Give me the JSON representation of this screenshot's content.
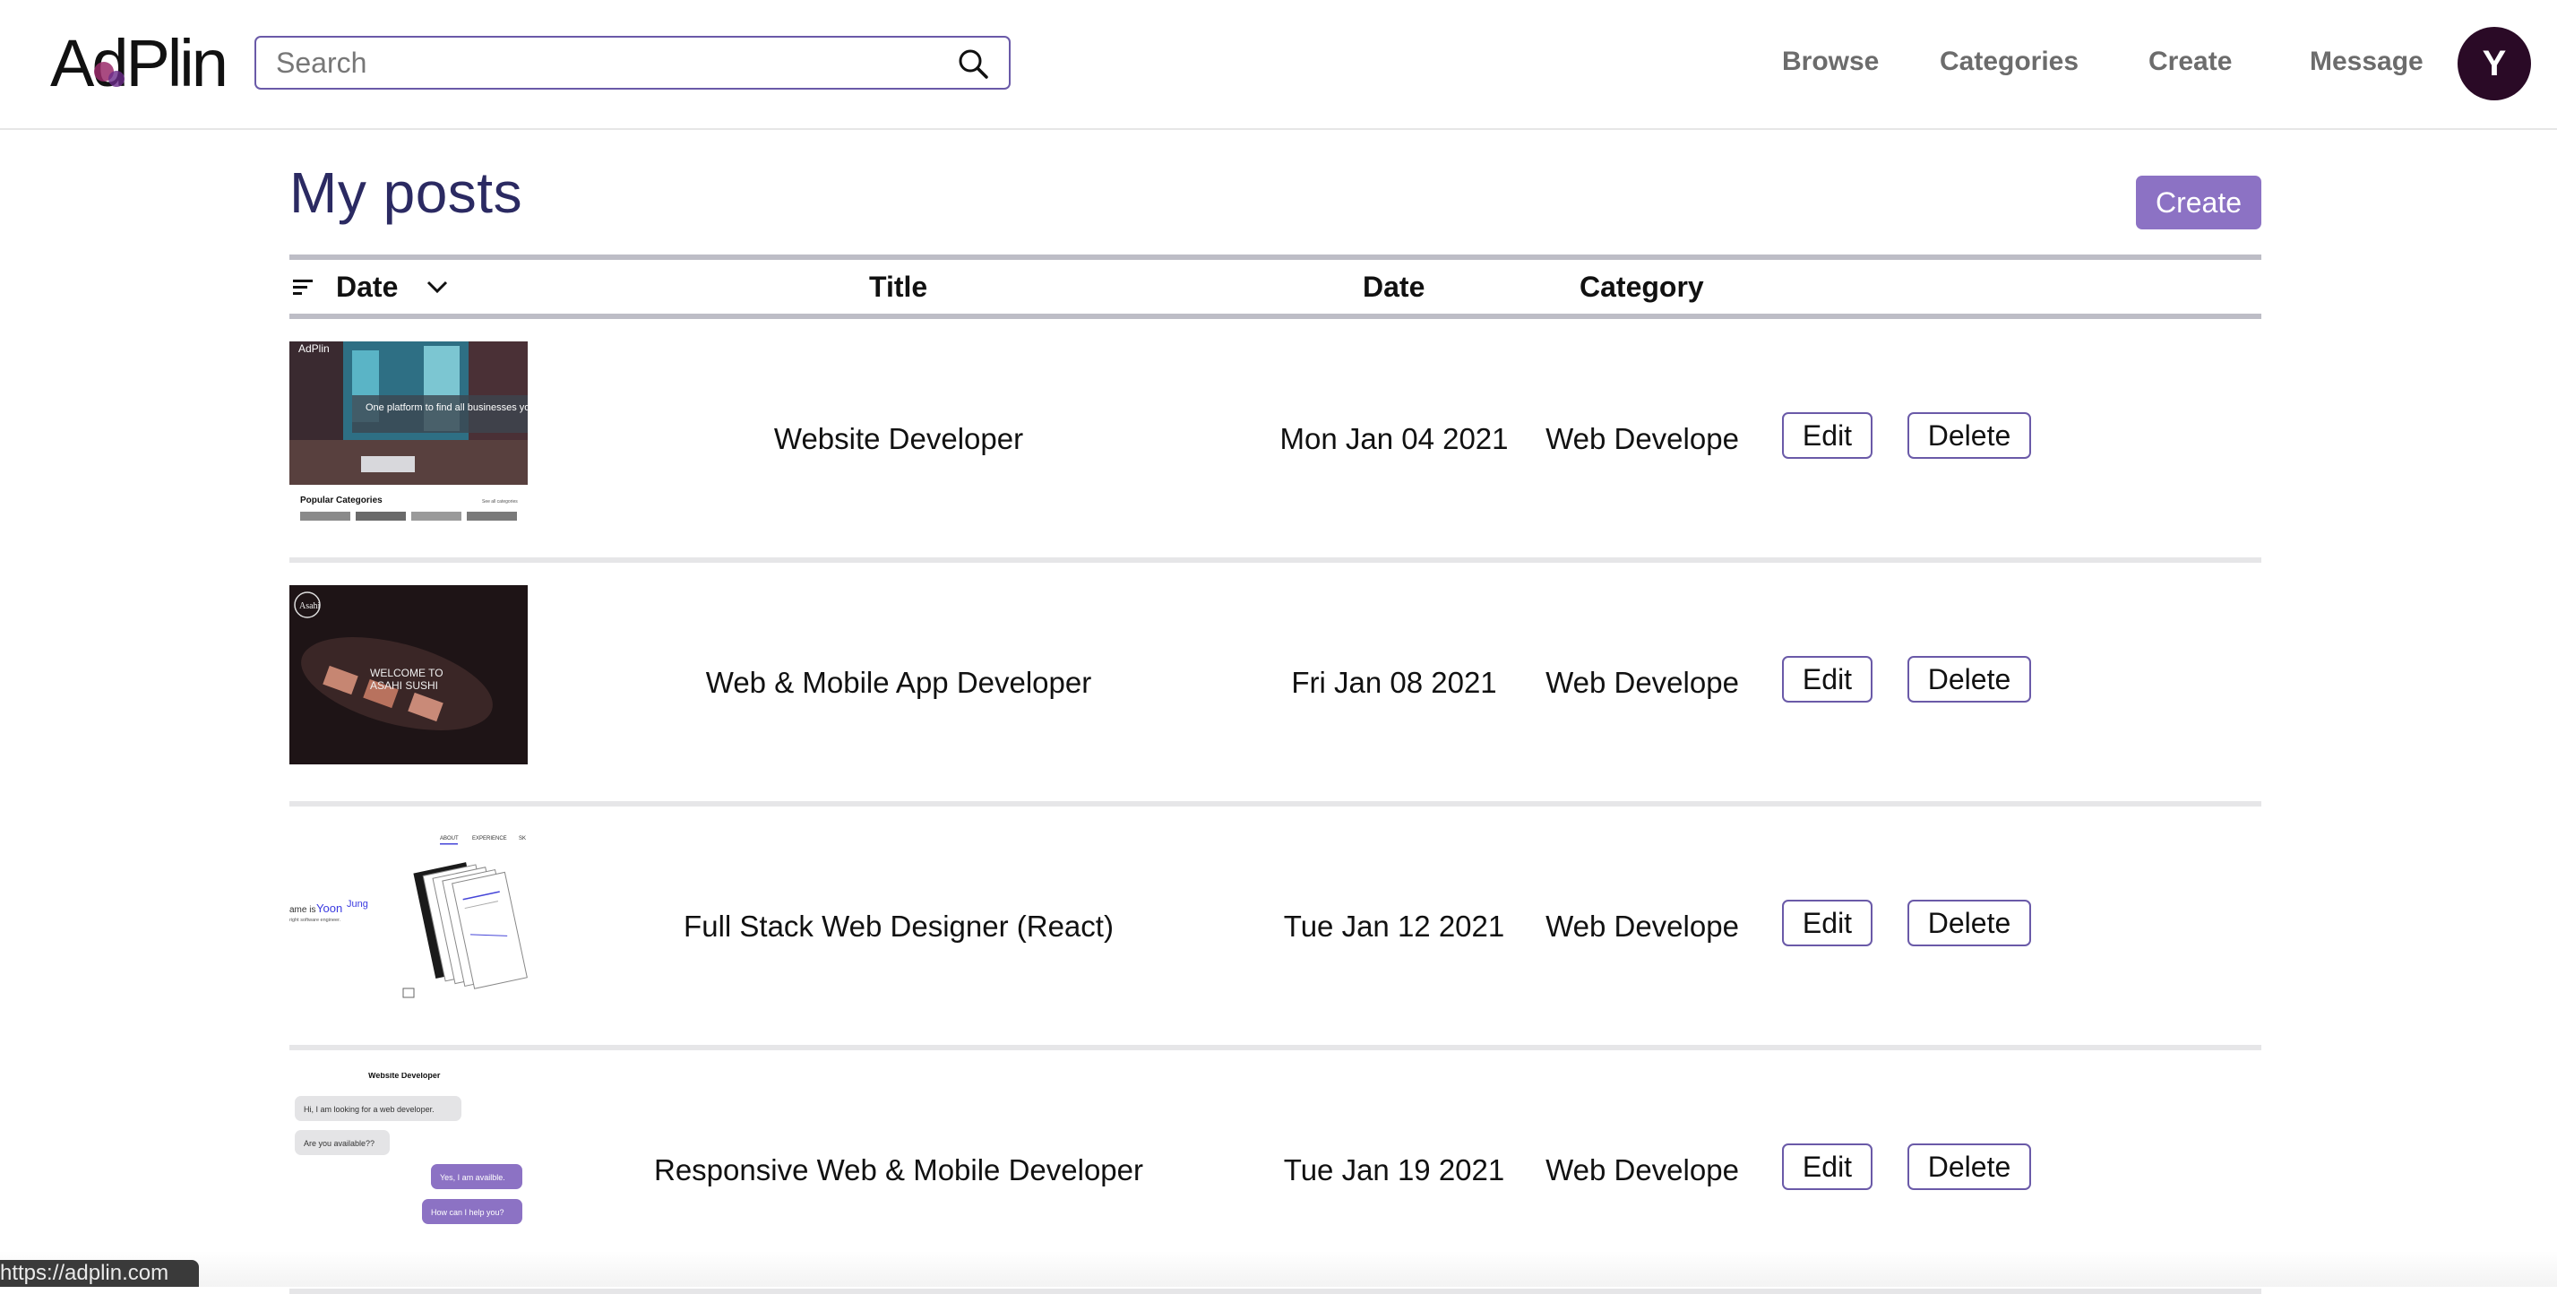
{
  "header": {
    "logo_text": "AdPlin",
    "search_placeholder": "Search",
    "nav": [
      "Browse",
      "Categories",
      "Create",
      "Message"
    ],
    "avatar_initial": "Y"
  },
  "main": {
    "title": "My posts",
    "create_label": "Create",
    "sort_label": "Date",
    "columns": {
      "title": "Title",
      "date": "Date",
      "category": "Category"
    },
    "posts": [
      {
        "title": "Website Developer",
        "date": "Mon Jan 04 2021",
        "category": "Web Develope",
        "edit": "Edit",
        "delete": "Delete",
        "thumb": {
          "logo": "AdPlin",
          "headline": "One platform to find all businesses you need.",
          "section": "Popular Categories",
          "link": "See all categories"
        }
      },
      {
        "title": "Web & Mobile App Developer",
        "date": "Fri Jan 08 2021",
        "category": "Web Develope",
        "edit": "Edit",
        "delete": "Delete",
        "thumb": {
          "logo": "Asahi",
          "headline": "WELCOME TO",
          "headline2": "ASAHI SUSHI"
        }
      },
      {
        "title": "Full Stack Web Designer (React)",
        "date": "Tue Jan 12 2021",
        "category": "Web Develope",
        "edit": "Edit",
        "delete": "Delete",
        "thumb": {
          "nav1": "ABOUT",
          "nav2": "EXPERIENCE",
          "nav3": "SK",
          "intro": "ame is",
          "name": "Yoon",
          "name2": "Jung",
          "sub": "right software engineer."
        }
      },
      {
        "title": "Responsive Web & Mobile Developer",
        "date": "Tue Jan 19 2021",
        "category": "Web Develope",
        "edit": "Edit",
        "delete": "Delete",
        "thumb": {
          "header": "Website Developer",
          "m1": "Hi, I am looking for a web developer.",
          "m2": "Are you available??",
          "m3": "Yes, I am availble.",
          "m4": "How can I help you?"
        }
      }
    ]
  },
  "status_url": "https://adplin.com",
  "colors": {
    "accent": "#8c72c4",
    "title": "#2b2a62",
    "avatar": "#2a0a26",
    "border": "#6a5aa8"
  }
}
